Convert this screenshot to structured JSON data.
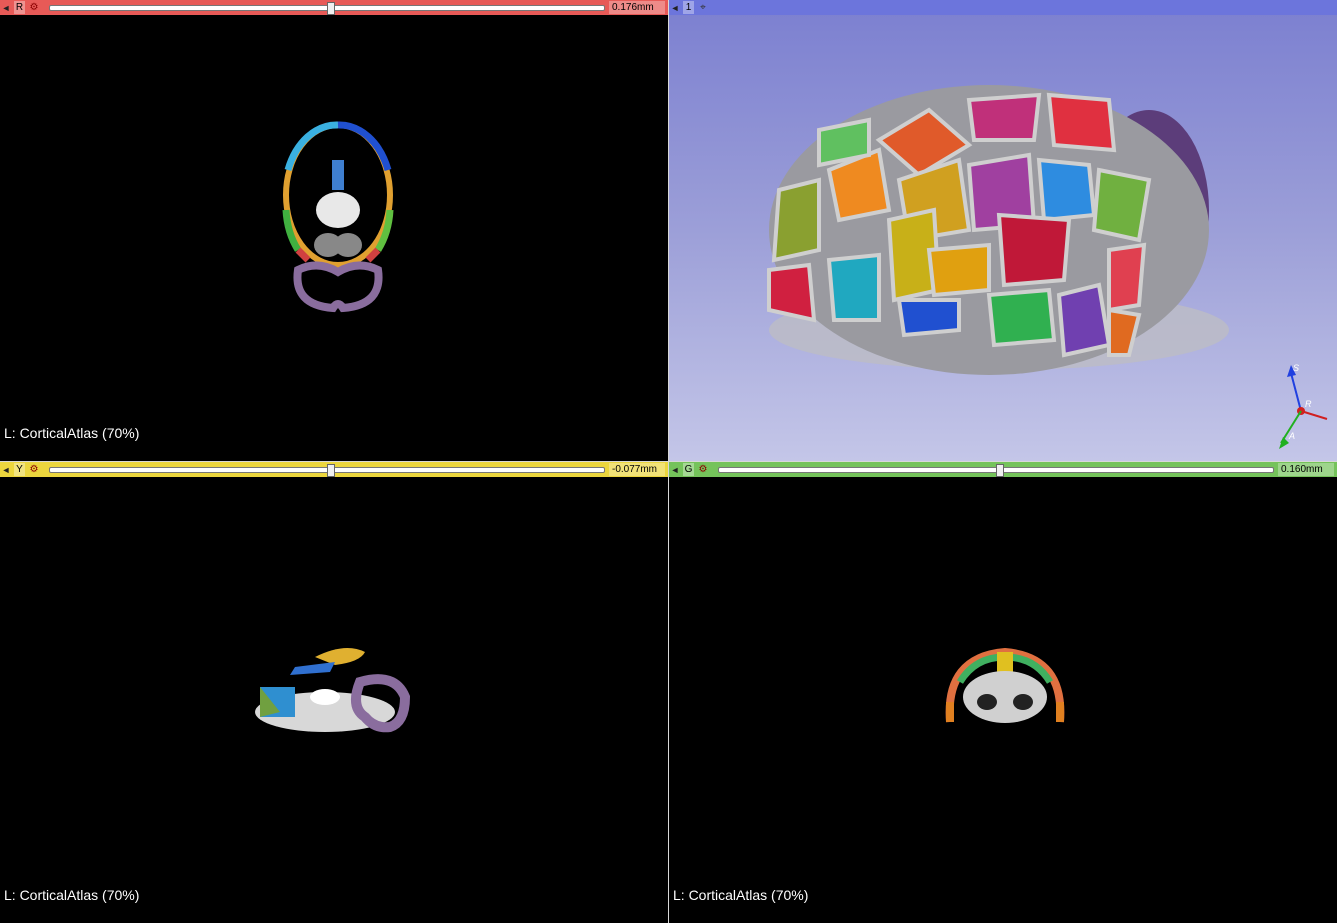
{
  "views": {
    "red": {
      "letter": "R",
      "offset": "0.176mm",
      "slider_fraction": 0.5,
      "color": "#e75a57",
      "corner_label": "L: CorticalAtlas (70%)"
    },
    "threed": {
      "letter": "1",
      "color": "#6c75dc",
      "axis_labels": {
        "s": "S",
        "r": "R",
        "a": "A"
      }
    },
    "yellow": {
      "letter": "Y",
      "offset": "-0.077mm",
      "slider_fraction": 0.5,
      "color": "#ecd63e",
      "corner_label": "L: CorticalAtlas (70%)"
    },
    "green": {
      "letter": "G",
      "offset": "0.160mm",
      "slider_fraction": 0.5,
      "color": "#75c35b",
      "corner_label": "L: CorticalAtlas (70%)"
    }
  },
  "icons": {
    "pin": "pin-icon",
    "link": "link-icon",
    "center": "center-view-icon"
  }
}
